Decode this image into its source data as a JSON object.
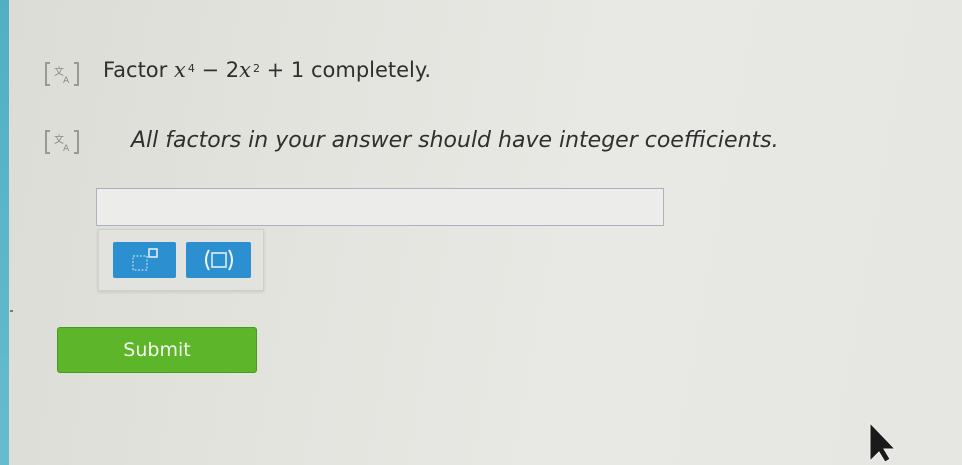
{
  "question": {
    "prefix": "Factor",
    "var1": "x",
    "exp1": "4",
    "op1": " − 2",
    "var2": "x",
    "exp2": "2",
    "suffix": " + 1 completely."
  },
  "instruction": "All factors in your answer should have integer coefficients.",
  "answer": {
    "value": "",
    "placeholder": ""
  },
  "toolbar": {
    "exponent_button_icon": "superscript-box-icon",
    "parentheses_button_icon": "parentheses-icon"
  },
  "submit_label": "Submit",
  "colors": {
    "tool_button": "#2c8fd0",
    "submit_button": "#5db52a",
    "left_strip": "#4fb0c4"
  }
}
